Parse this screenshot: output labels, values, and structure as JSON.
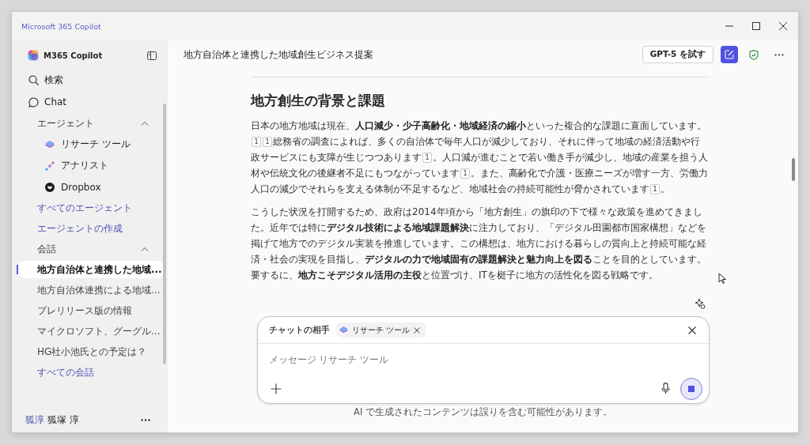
{
  "window": {
    "title": "Microsoft 365 Copilot"
  },
  "sidebar": {
    "brand": "M365 Copilot",
    "nav": [
      {
        "label": "検索"
      },
      {
        "label": "Chat"
      }
    ],
    "sections": [
      {
        "title": "エージェント",
        "expanded": true,
        "items": [
          {
            "label": "リサーチ ツール",
            "kind": "agent"
          },
          {
            "label": "アナリスト",
            "kind": "agent"
          },
          {
            "label": "Dropbox",
            "kind": "agent"
          },
          {
            "label": "すべてのエージェント",
            "kind": "link"
          },
          {
            "label": "エージェントの作成",
            "kind": "link"
          }
        ]
      },
      {
        "title": "会話",
        "expanded": true,
        "items": [
          {
            "label": "地方自治体と連携した地域...",
            "kind": "chat",
            "selected": true
          },
          {
            "label": "地方自治体連携による地域...",
            "kind": "chat",
            "selected": false
          },
          {
            "label": "プレリリース版の情報",
            "kind": "chat",
            "selected": false
          },
          {
            "label": "マイクロソフト、グーグル...",
            "kind": "chat",
            "selected": false
          },
          {
            "label": "HG社小池氏との予定は？",
            "kind": "chat",
            "selected": false
          },
          {
            "label": "すべての会話",
            "kind": "link"
          }
        ]
      }
    ],
    "user": {
      "avatar": "狐淳",
      "name": "狐塚 淳"
    }
  },
  "header": {
    "title": "地方自治体と連携した地域創生ビジネス提案",
    "try_button": "GPT-5 を試す"
  },
  "article": {
    "heading": "地方創生の背景と課題",
    "paragraphs": [
      [
        {
          "kind": "text",
          "text": "日本の地方地域は現在、"
        },
        {
          "kind": "bold",
          "text": "人口減少・少子高齢化・地域経済の縮小"
        },
        {
          "kind": "text",
          "text": "といった複合的な課題に直面しています。"
        },
        {
          "kind": "cite",
          "text": "1"
        },
        {
          "kind": "cite",
          "text": "1"
        },
        {
          "kind": "text",
          "text": "総務省の調査によれば、多くの自治体で毎年人口が減少しており、それに伴って地域の経済活動や行政サービスにも支障が生じつつあります"
        },
        {
          "kind": "cite",
          "text": "1"
        },
        {
          "kind": "text",
          "text": "。人口減が進むことで若い働き手が減少し、地域の産業を担う人材や伝統文化の後継者不足にもつながっています"
        },
        {
          "kind": "cite",
          "text": "1"
        },
        {
          "kind": "text",
          "text": "。また、高齢化で介護・医療ニーズが増す一方、労働力人口の減少でそれらを支える体制が不足するなど、地域社会の持続可能性が脅かされています"
        },
        {
          "kind": "cite",
          "text": "1"
        },
        {
          "kind": "text",
          "text": "。"
        }
      ],
      [
        {
          "kind": "text",
          "text": "こうした状況を打開するため、政府は2014年頃から「地方創生」の旗印の下で様々な政策を進めてきました。近年では特に"
        },
        {
          "kind": "bold",
          "text": "デジタル技術による地域課題解決"
        },
        {
          "kind": "text",
          "text": "に注力しており、「デジタル田園都市国家構想」などを掲げて地方でのデジタル実装を推進しています。この構想は、地方における暮らしの質向上と持続可能な経済・社会の実現を目指し、"
        },
        {
          "kind": "bold",
          "text": "デジタルの力で地域固有の課題解決と魅力向上を図る"
        },
        {
          "kind": "text",
          "text": "ことを目的としています。要するに、"
        },
        {
          "kind": "bold",
          "text": "地方こそデジタル活用の主役"
        },
        {
          "kind": "text",
          "text": "と位置づけ、ITを梃子に地方の活性化を図る戦略です。"
        }
      ]
    ]
  },
  "composer": {
    "chat_with_label": "チャットの相手",
    "agent_chip": "リサーチ ツール",
    "placeholder": "メッセージ リサーチ ツール"
  },
  "disclaimer": "AI で生成されたコンテンツは誤りを含む可能性があります。"
}
